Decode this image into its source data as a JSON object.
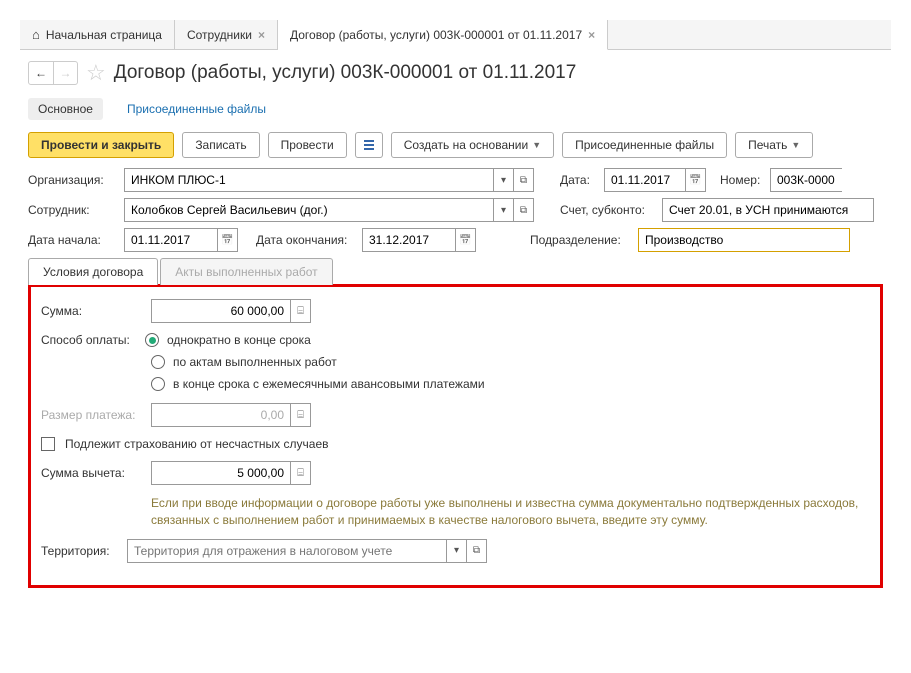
{
  "tabs": {
    "home": "Начальная страница",
    "employees": "Сотрудники",
    "contract": "Договор (работы, услуги) 003К-000001 от 01.11.2017"
  },
  "title": "Договор (работы, услуги) 003К-000001 от 01.11.2017",
  "subnav": {
    "main": "Основное",
    "files": "Присоединенные файлы"
  },
  "toolbar": {
    "post_close": "Провести и закрыть",
    "save": "Записать",
    "post": "Провести",
    "create_based": "Создать на основании",
    "attached": "Присоединенные файлы",
    "print": "Печать"
  },
  "labels": {
    "org": "Организация:",
    "employee": "Сотрудник:",
    "date_start": "Дата начала:",
    "date_end": "Дата окончания:",
    "date": "Дата:",
    "number": "Номер:",
    "account": "Счет, субконто:",
    "subdivision": "Подразделение:"
  },
  "values": {
    "org": "ИНКОМ ПЛЮС-1",
    "employee": "Колобков Сергей Васильевич (дог.)",
    "date_start": "01.11.2017",
    "date_end": "31.12.2017",
    "date": "01.11.2017",
    "number": "003К-0000",
    "account": "Счет 20.01, в УСН принимаются",
    "subdivision": "Производство"
  },
  "tabs2": {
    "terms": "Условия договора",
    "acts": "Акты выполненных работ"
  },
  "terms": {
    "sum_lbl": "Сумма:",
    "sum_val": "60 000,00",
    "pay_method_lbl": "Способ оплаты:",
    "pay_opt1": "однократно в конце срока",
    "pay_opt2": "по актам выполненных работ",
    "pay_opt3": "в конце срока с ежемесячными авансовыми платежами",
    "payment_size_lbl": "Размер платежа:",
    "payment_size_val": "0,00",
    "insurance_lbl": "Подлежит страхованию от несчастных случаев",
    "deduction_lbl": "Сумма вычета:",
    "deduction_val": "5 000,00",
    "hint": "Если при вводе информации о договоре работы уже выполнены и известна сумма документально подтвержденных расходов, связанных с выполнением работ и принимаемых в качестве налогового вычета, введите эту сумму.",
    "territory_lbl": "Территория:",
    "territory_ph": "Территория для отражения в налоговом учете"
  }
}
